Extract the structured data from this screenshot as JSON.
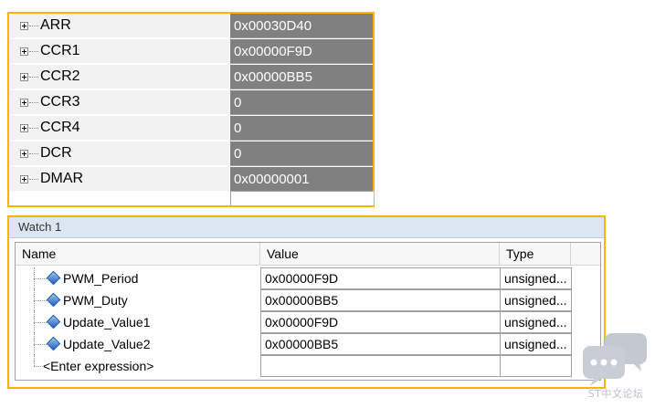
{
  "registers": [
    {
      "name": "ARR",
      "value": "0x00030D40"
    },
    {
      "name": "CCR1",
      "value": "0x00000F9D"
    },
    {
      "name": "CCR2",
      "value": "0x00000BB5"
    },
    {
      "name": "CCR3",
      "value": "0"
    },
    {
      "name": "CCR4",
      "value": "0"
    },
    {
      "name": "DCR",
      "value": "0"
    },
    {
      "name": "DMAR",
      "value": "0x00000001"
    }
  ],
  "watch": {
    "title": "Watch 1",
    "columns": {
      "name": "Name",
      "value": "Value",
      "type": "Type"
    },
    "rows": [
      {
        "name": "PWM_Period",
        "value": "0x00000F9D",
        "type": "unsigned..."
      },
      {
        "name": "PWM_Duty",
        "value": "0x00000BB5",
        "type": "unsigned..."
      },
      {
        "name": "Update_Value1",
        "value": "0x00000F9D",
        "type": "unsigned..."
      },
      {
        "name": "Update_Value2",
        "value": "0x00000BB5",
        "type": "unsigned..."
      }
    ],
    "enter_expression": "<Enter expression>"
  },
  "watermark": {
    "text": "ST中文论坛"
  },
  "colors": {
    "highlight_border": "#f5b800",
    "register_value_bg": "#808080",
    "watch_title_bg": "#dce6f2"
  }
}
